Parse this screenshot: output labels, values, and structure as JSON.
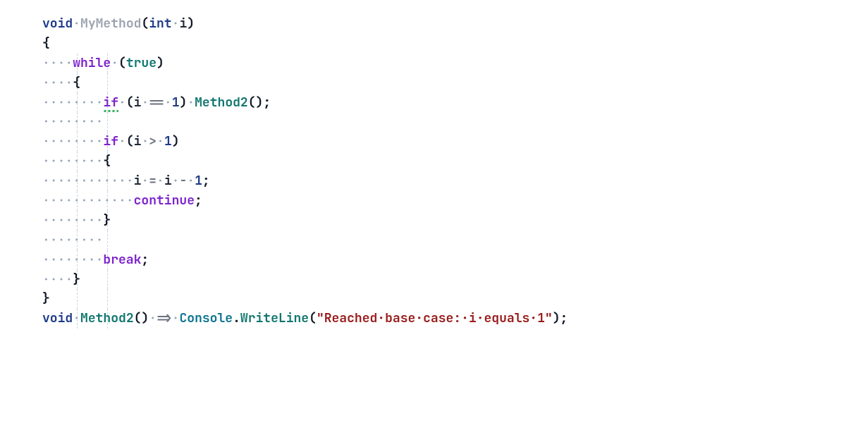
{
  "colors": {
    "keyword": "#1e3a8a",
    "flow": "#7e22ce",
    "method_declared": "#9ca3af",
    "function_call": "#0f766e",
    "class": "#0e7490",
    "identifier": "#1f2937",
    "number": "#1e3a8a",
    "boolean": "#0f766e",
    "punct": "#111827",
    "operator": "#6b7280",
    "string": "#991b1b",
    "whitespace_dot": "#94a3b8",
    "indent_guide": "#cbd5e1",
    "squiggle": "#16a34a"
  },
  "guides": {
    "positions_ch": [
      4.5,
      8.5
    ],
    "from_line": 3,
    "to_line": 16
  },
  "lines": [
    {
      "n": 1,
      "tokens": [
        {
          "t": "void",
          "c": "kw"
        },
        {
          "t": "·",
          "c": "ws"
        },
        {
          "t": "MyMethod",
          "c": "mname"
        },
        {
          "t": "(",
          "c": "punc"
        },
        {
          "t": "int",
          "c": "kw"
        },
        {
          "t": "·",
          "c": "ws"
        },
        {
          "t": "i",
          "c": "id"
        },
        {
          "t": ")",
          "c": "punc"
        }
      ]
    },
    {
      "n": 2,
      "tokens": [
        {
          "t": "{",
          "c": "punc"
        }
      ]
    },
    {
      "n": 3,
      "tokens": [
        {
          "t": "····",
          "c": "ws"
        },
        {
          "t": "while",
          "c": "flow"
        },
        {
          "t": "·",
          "c": "ws"
        },
        {
          "t": "(",
          "c": "punc"
        },
        {
          "t": "true",
          "c": "btrue"
        },
        {
          "t": ")",
          "c": "punc"
        }
      ]
    },
    {
      "n": 4,
      "tokens": [
        {
          "t": "····",
          "c": "ws"
        },
        {
          "t": "{",
          "c": "punc"
        }
      ]
    },
    {
      "n": 5,
      "tokens": [
        {
          "t": "········",
          "c": "ws"
        },
        {
          "t": "if",
          "c": "flow",
          "squiggle": true
        },
        {
          "t": "·",
          "c": "ws"
        },
        {
          "t": "(",
          "c": "punc"
        },
        {
          "t": "i",
          "c": "id"
        },
        {
          "t": "·",
          "c": "ws"
        },
        {
          "t": "==",
          "c": "op"
        },
        {
          "t": "·",
          "c": "ws"
        },
        {
          "t": "1",
          "c": "num"
        },
        {
          "t": ")",
          "c": "punc"
        },
        {
          "t": "·",
          "c": "ws"
        },
        {
          "t": "Method2",
          "c": "func"
        },
        {
          "t": "()",
          "c": "punc"
        },
        {
          "t": ";",
          "c": "punc"
        }
      ]
    },
    {
      "n": 6,
      "tokens": [
        {
          "t": "········",
          "c": "ws"
        }
      ]
    },
    {
      "n": 7,
      "tokens": [
        {
          "t": "········",
          "c": "ws"
        },
        {
          "t": "if",
          "c": "flow"
        },
        {
          "t": "·",
          "c": "ws"
        },
        {
          "t": "(",
          "c": "punc"
        },
        {
          "t": "i",
          "c": "id"
        },
        {
          "t": "·",
          "c": "ws"
        },
        {
          "t": ">",
          "c": "op"
        },
        {
          "t": "·",
          "c": "ws"
        },
        {
          "t": "1",
          "c": "num"
        },
        {
          "t": ")",
          "c": "punc"
        }
      ]
    },
    {
      "n": 8,
      "tokens": [
        {
          "t": "········",
          "c": "ws"
        },
        {
          "t": "{",
          "c": "punc"
        }
      ]
    },
    {
      "n": 9,
      "tokens": [
        {
          "t": "············",
          "c": "ws"
        },
        {
          "t": "i",
          "c": "id"
        },
        {
          "t": "·",
          "c": "ws"
        },
        {
          "t": "=",
          "c": "op"
        },
        {
          "t": "·",
          "c": "ws"
        },
        {
          "t": "i",
          "c": "id"
        },
        {
          "t": "·",
          "c": "ws"
        },
        {
          "t": "-",
          "c": "op"
        },
        {
          "t": "·",
          "c": "ws"
        },
        {
          "t": "1",
          "c": "num"
        },
        {
          "t": ";",
          "c": "punc"
        }
      ]
    },
    {
      "n": 10,
      "tokens": [
        {
          "t": "············",
          "c": "ws"
        },
        {
          "t": "continue",
          "c": "flow"
        },
        {
          "t": ";",
          "c": "punc"
        }
      ]
    },
    {
      "n": 11,
      "tokens": [
        {
          "t": "········",
          "c": "ws"
        },
        {
          "t": "}",
          "c": "punc"
        }
      ]
    },
    {
      "n": 12,
      "tokens": [
        {
          "t": "········",
          "c": "ws"
        }
      ]
    },
    {
      "n": 13,
      "tokens": [
        {
          "t": "········",
          "c": "ws"
        },
        {
          "t": "break",
          "c": "flow"
        },
        {
          "t": ";",
          "c": "punc"
        }
      ]
    },
    {
      "n": 14,
      "tokens": [
        {
          "t": "····",
          "c": "ws"
        },
        {
          "t": "}",
          "c": "punc"
        }
      ]
    },
    {
      "n": 15,
      "tokens": [
        {
          "t": "}",
          "c": "punc"
        }
      ]
    },
    {
      "n": 16,
      "tokens": [
        {
          "t": "void",
          "c": "kw"
        },
        {
          "t": "·",
          "c": "ws"
        },
        {
          "t": "Method2",
          "c": "func"
        },
        {
          "t": "()",
          "c": "punc"
        },
        {
          "t": "·",
          "c": "ws"
        },
        {
          "t": "=>",
          "c": "op"
        },
        {
          "t": "·",
          "c": "ws"
        },
        {
          "t": "Console",
          "c": "cls"
        },
        {
          "t": ".",
          "c": "punc"
        },
        {
          "t": "WriteLine",
          "c": "func"
        },
        {
          "t": "(",
          "c": "punc"
        },
        {
          "t": "\"Reached·base·case:·i·equals·1\"",
          "c": "str"
        },
        {
          "t": ")",
          "c": "punc"
        },
        {
          "t": ";",
          "c": "punc"
        }
      ]
    }
  ]
}
